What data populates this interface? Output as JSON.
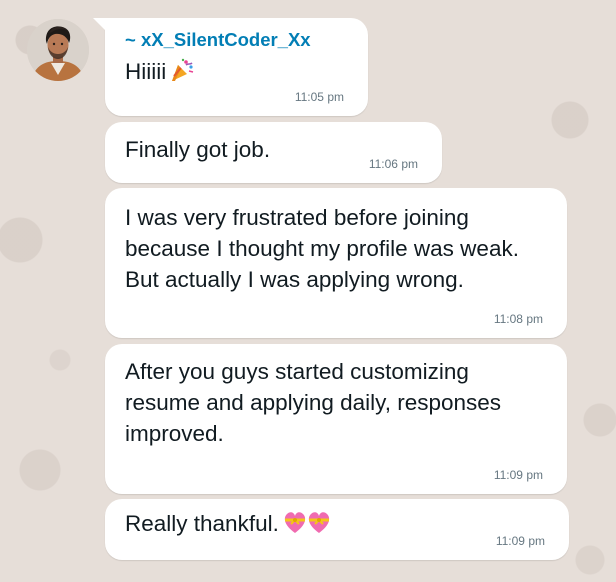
{
  "chat": {
    "sender_name": "~ xX_SilentCoder_Xx",
    "messages": [
      {
        "text": "Hiiiii",
        "emoji": "party-popper-icon",
        "time": "11:05 pm"
      },
      {
        "text": "Finally got job.",
        "time": "11:06 pm"
      },
      {
        "text": "I was very frustrated before joining\nbecause I thought my profile was weak.\nBut actually I was applying wrong.",
        "time": "11:08 pm"
      },
      {
        "text": "After you guys started customizing\nresume and applying daily, responses\nimproved.",
        "time": "11:09 pm"
      },
      {
        "text": "Really thankful.",
        "emoji": "heart-with-ribbon-icon",
        "time": "11:09 pm"
      }
    ]
  },
  "colors": {
    "background": "#e6ded8",
    "bubble": "#ffffff",
    "sender_name": "#027eb5",
    "timestamp": "#667781",
    "text": "#111b21"
  }
}
